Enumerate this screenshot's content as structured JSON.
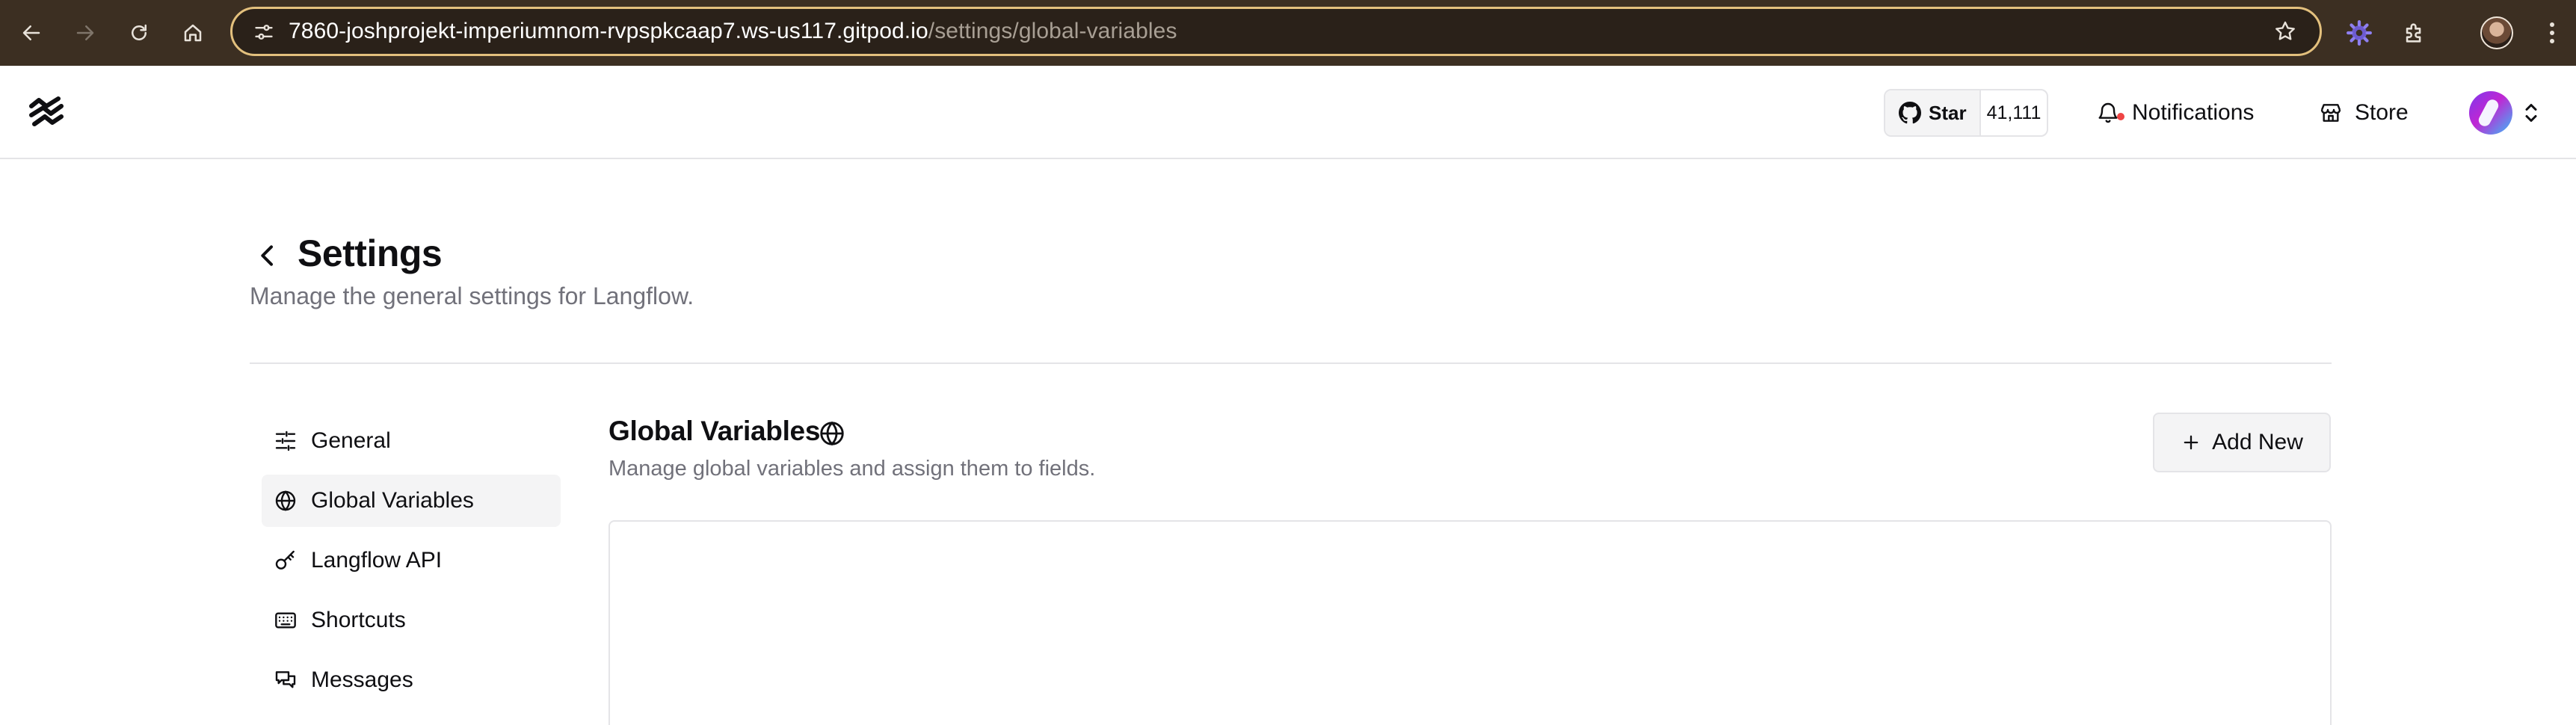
{
  "browser": {
    "url_host": "7860-joshprojekt-imperiumnom-rvpspkcaap7.ws-us117.gitpod.io",
    "url_path": "/settings/global-variables",
    "icons": [
      "back-arrow-icon",
      "forward-arrow-icon",
      "reload-icon",
      "home-icon",
      "site-info-icon",
      "bookmark-star-icon",
      "extension-gear-icon",
      "extensions-puzzle-icon",
      "profile-avatar",
      "menu-dots-icon"
    ],
    "colors": {
      "toolbar": "#3c2f22",
      "omnibox_border": "#e3c07d"
    }
  },
  "header": {
    "logo": "langflow-logo",
    "github": {
      "star_label": "Star",
      "star_count": "41,111"
    },
    "notifications_label": "Notifications",
    "store_label": "Store"
  },
  "settings": {
    "title": "Settings",
    "subtitle": "Manage the general settings for Langflow.",
    "sidebar": [
      {
        "label": "General",
        "icon": "sliders-icon",
        "active": false
      },
      {
        "label": "Global Variables",
        "icon": "globe-icon",
        "active": true
      },
      {
        "label": "Langflow API",
        "icon": "key-icon",
        "active": false
      },
      {
        "label": "Shortcuts",
        "icon": "keyboard-icon",
        "active": false
      },
      {
        "label": "Messages",
        "icon": "messages-icon",
        "active": false
      }
    ],
    "section": {
      "title": "Global Variables",
      "description": "Manage global variables and assign them to fields.",
      "add_button_label": "Add New"
    }
  }
}
